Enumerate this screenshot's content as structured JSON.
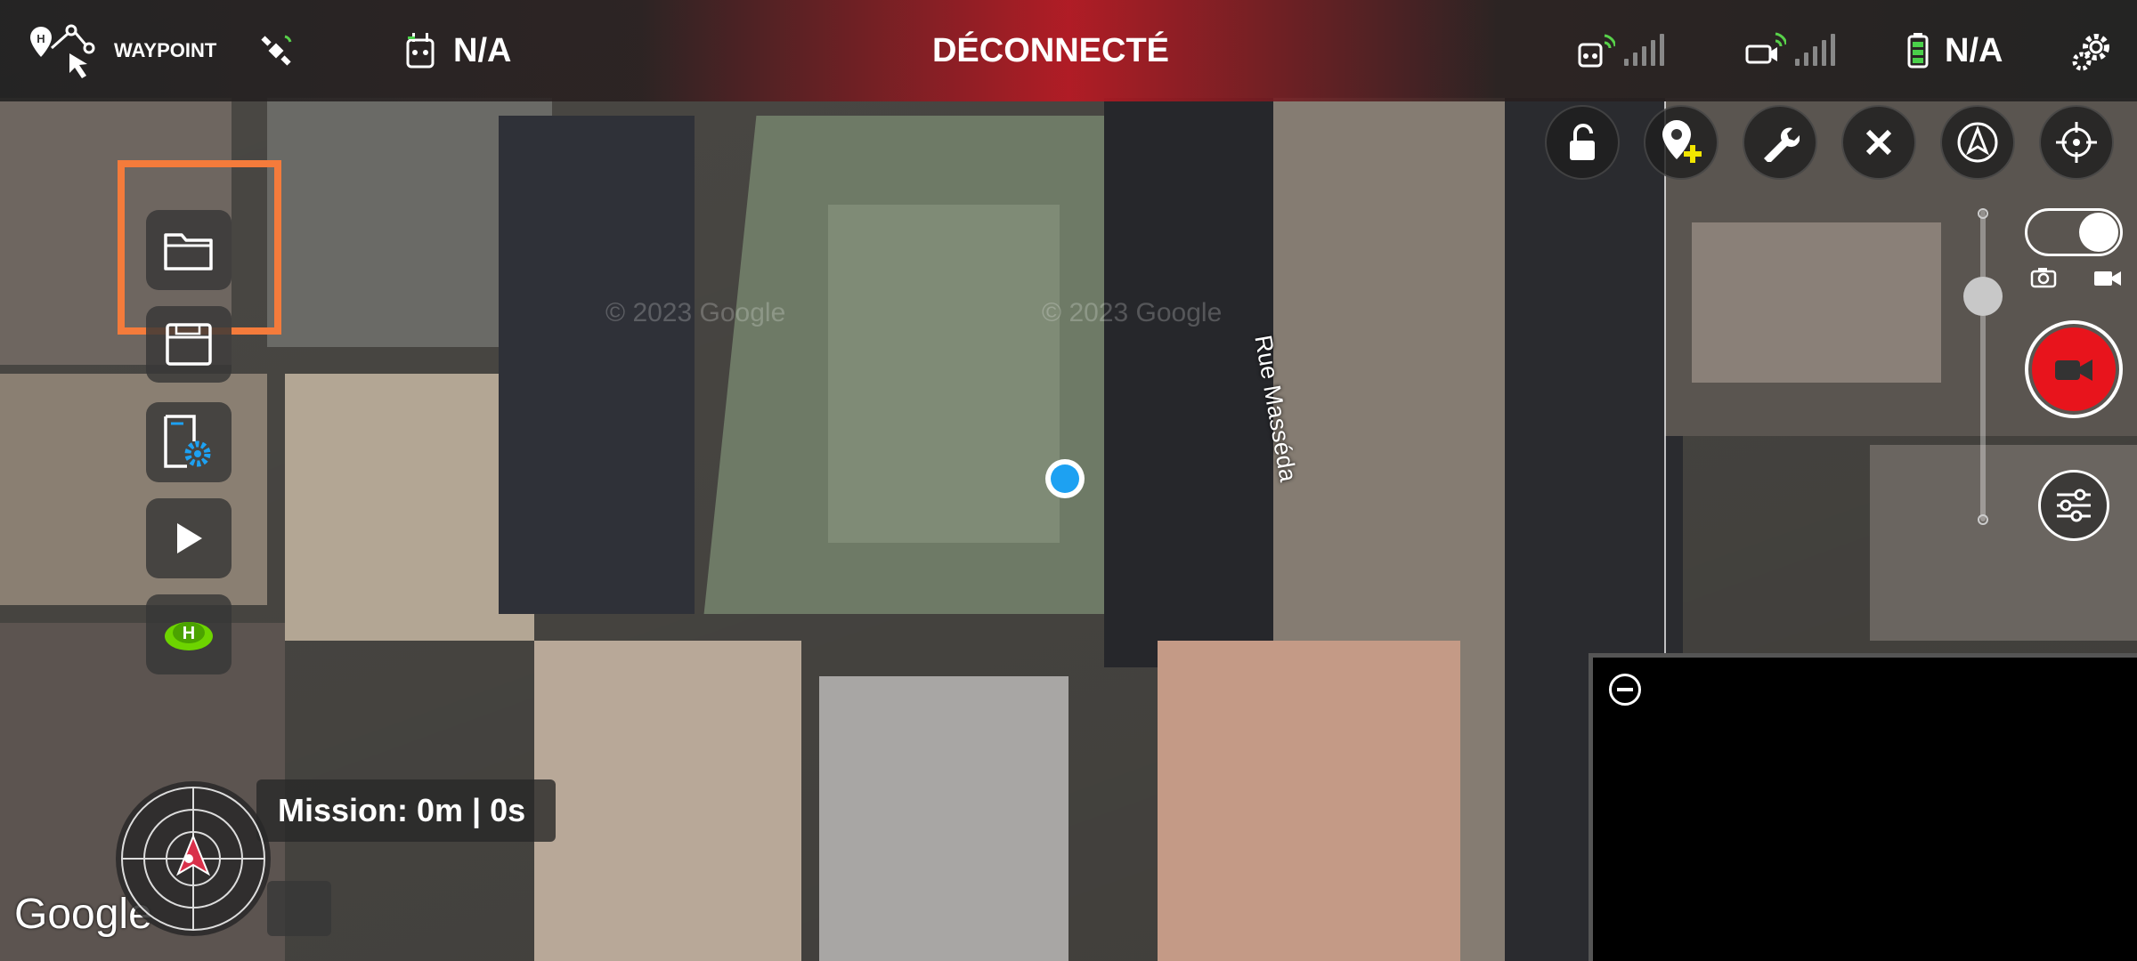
{
  "app": {
    "mode_label": "WAYPOINT",
    "status": "DÉCONNECTÉ",
    "remote_value": "N/A",
    "battery_value": "N/A"
  },
  "map": {
    "street_label": "Rue Masséda",
    "attribution": "Google",
    "watermark": "© 2023 Google"
  },
  "mission": {
    "label": "Mission: 0m | 0s"
  },
  "colors": {
    "status_red": "#c8202c",
    "highlight": "#f47b3b",
    "position_dot": "#1da1f2",
    "home_green": "#6dd400",
    "record_red": "#e8141c"
  },
  "icons": {
    "left_tools": [
      "folder-icon",
      "save-icon",
      "mission-settings-icon",
      "play-icon",
      "home-icon"
    ],
    "top_right": [
      "unlock-icon",
      "add-waypoint-icon",
      "wrench-icon",
      "close-icon",
      "navigation-icon",
      "locate-icon"
    ]
  }
}
